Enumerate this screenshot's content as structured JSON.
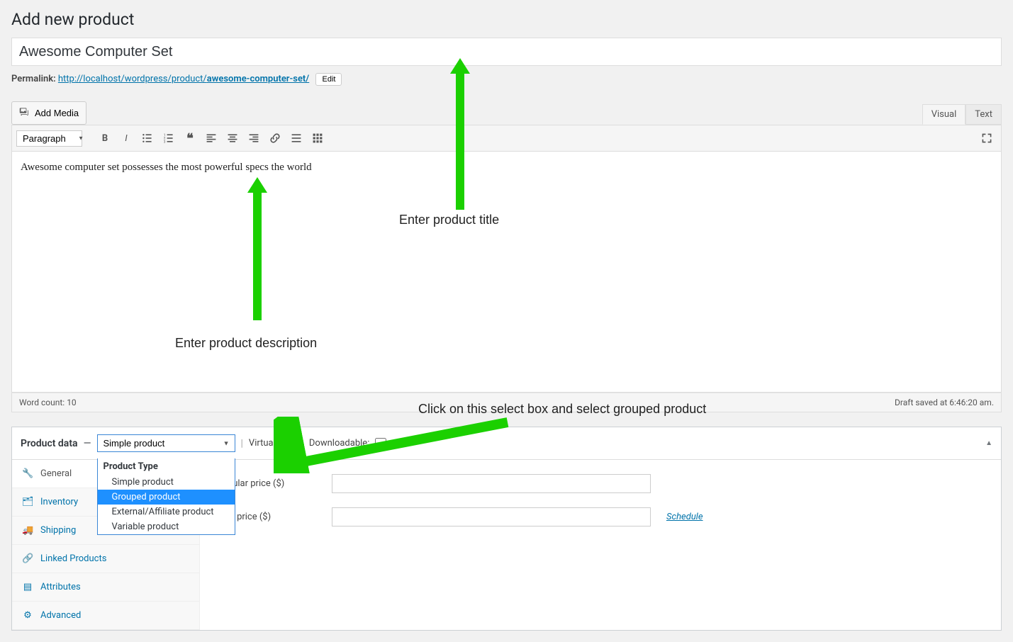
{
  "page": {
    "heading": "Add new product"
  },
  "product": {
    "title": "Awesome Computer Set",
    "permalink_label": "Permalink:",
    "permalink_base": "http://localhost/wordpress/product/",
    "permalink_slug": "awesome-computer-set/",
    "edit_btn": "Edit",
    "description": "Awesome computer set possesses the most powerful specs the world"
  },
  "editor": {
    "add_media": "Add Media",
    "tabs": {
      "visual": "Visual",
      "text": "Text"
    },
    "format": "Paragraph",
    "word_count_label": "Word count: ",
    "word_count": "10",
    "draft_status": "Draft saved at 6:46:20 am."
  },
  "annotations": {
    "title": "Enter product title",
    "description": "Enter product description",
    "select": "Click on this select box and select grouped product"
  },
  "product_data": {
    "title": "Product data",
    "dash": "—",
    "selected": "Simple product",
    "virtual": "Virtual:",
    "downloadable": "Downloadable:",
    "dd_heading": "Product Type",
    "options": {
      "simple": "Simple product",
      "grouped": "Grouped product",
      "external": "External/Affiliate product",
      "variable": "Variable product"
    },
    "tabs": {
      "general": "General",
      "inventory": "Inventory",
      "shipping": "Shipping",
      "linked": "Linked Products",
      "attributes": "Attributes",
      "advanced": "Advanced"
    },
    "fields": {
      "regular": "Regular price ($)",
      "sale": "Sale price ($)",
      "schedule": "Schedule"
    }
  }
}
